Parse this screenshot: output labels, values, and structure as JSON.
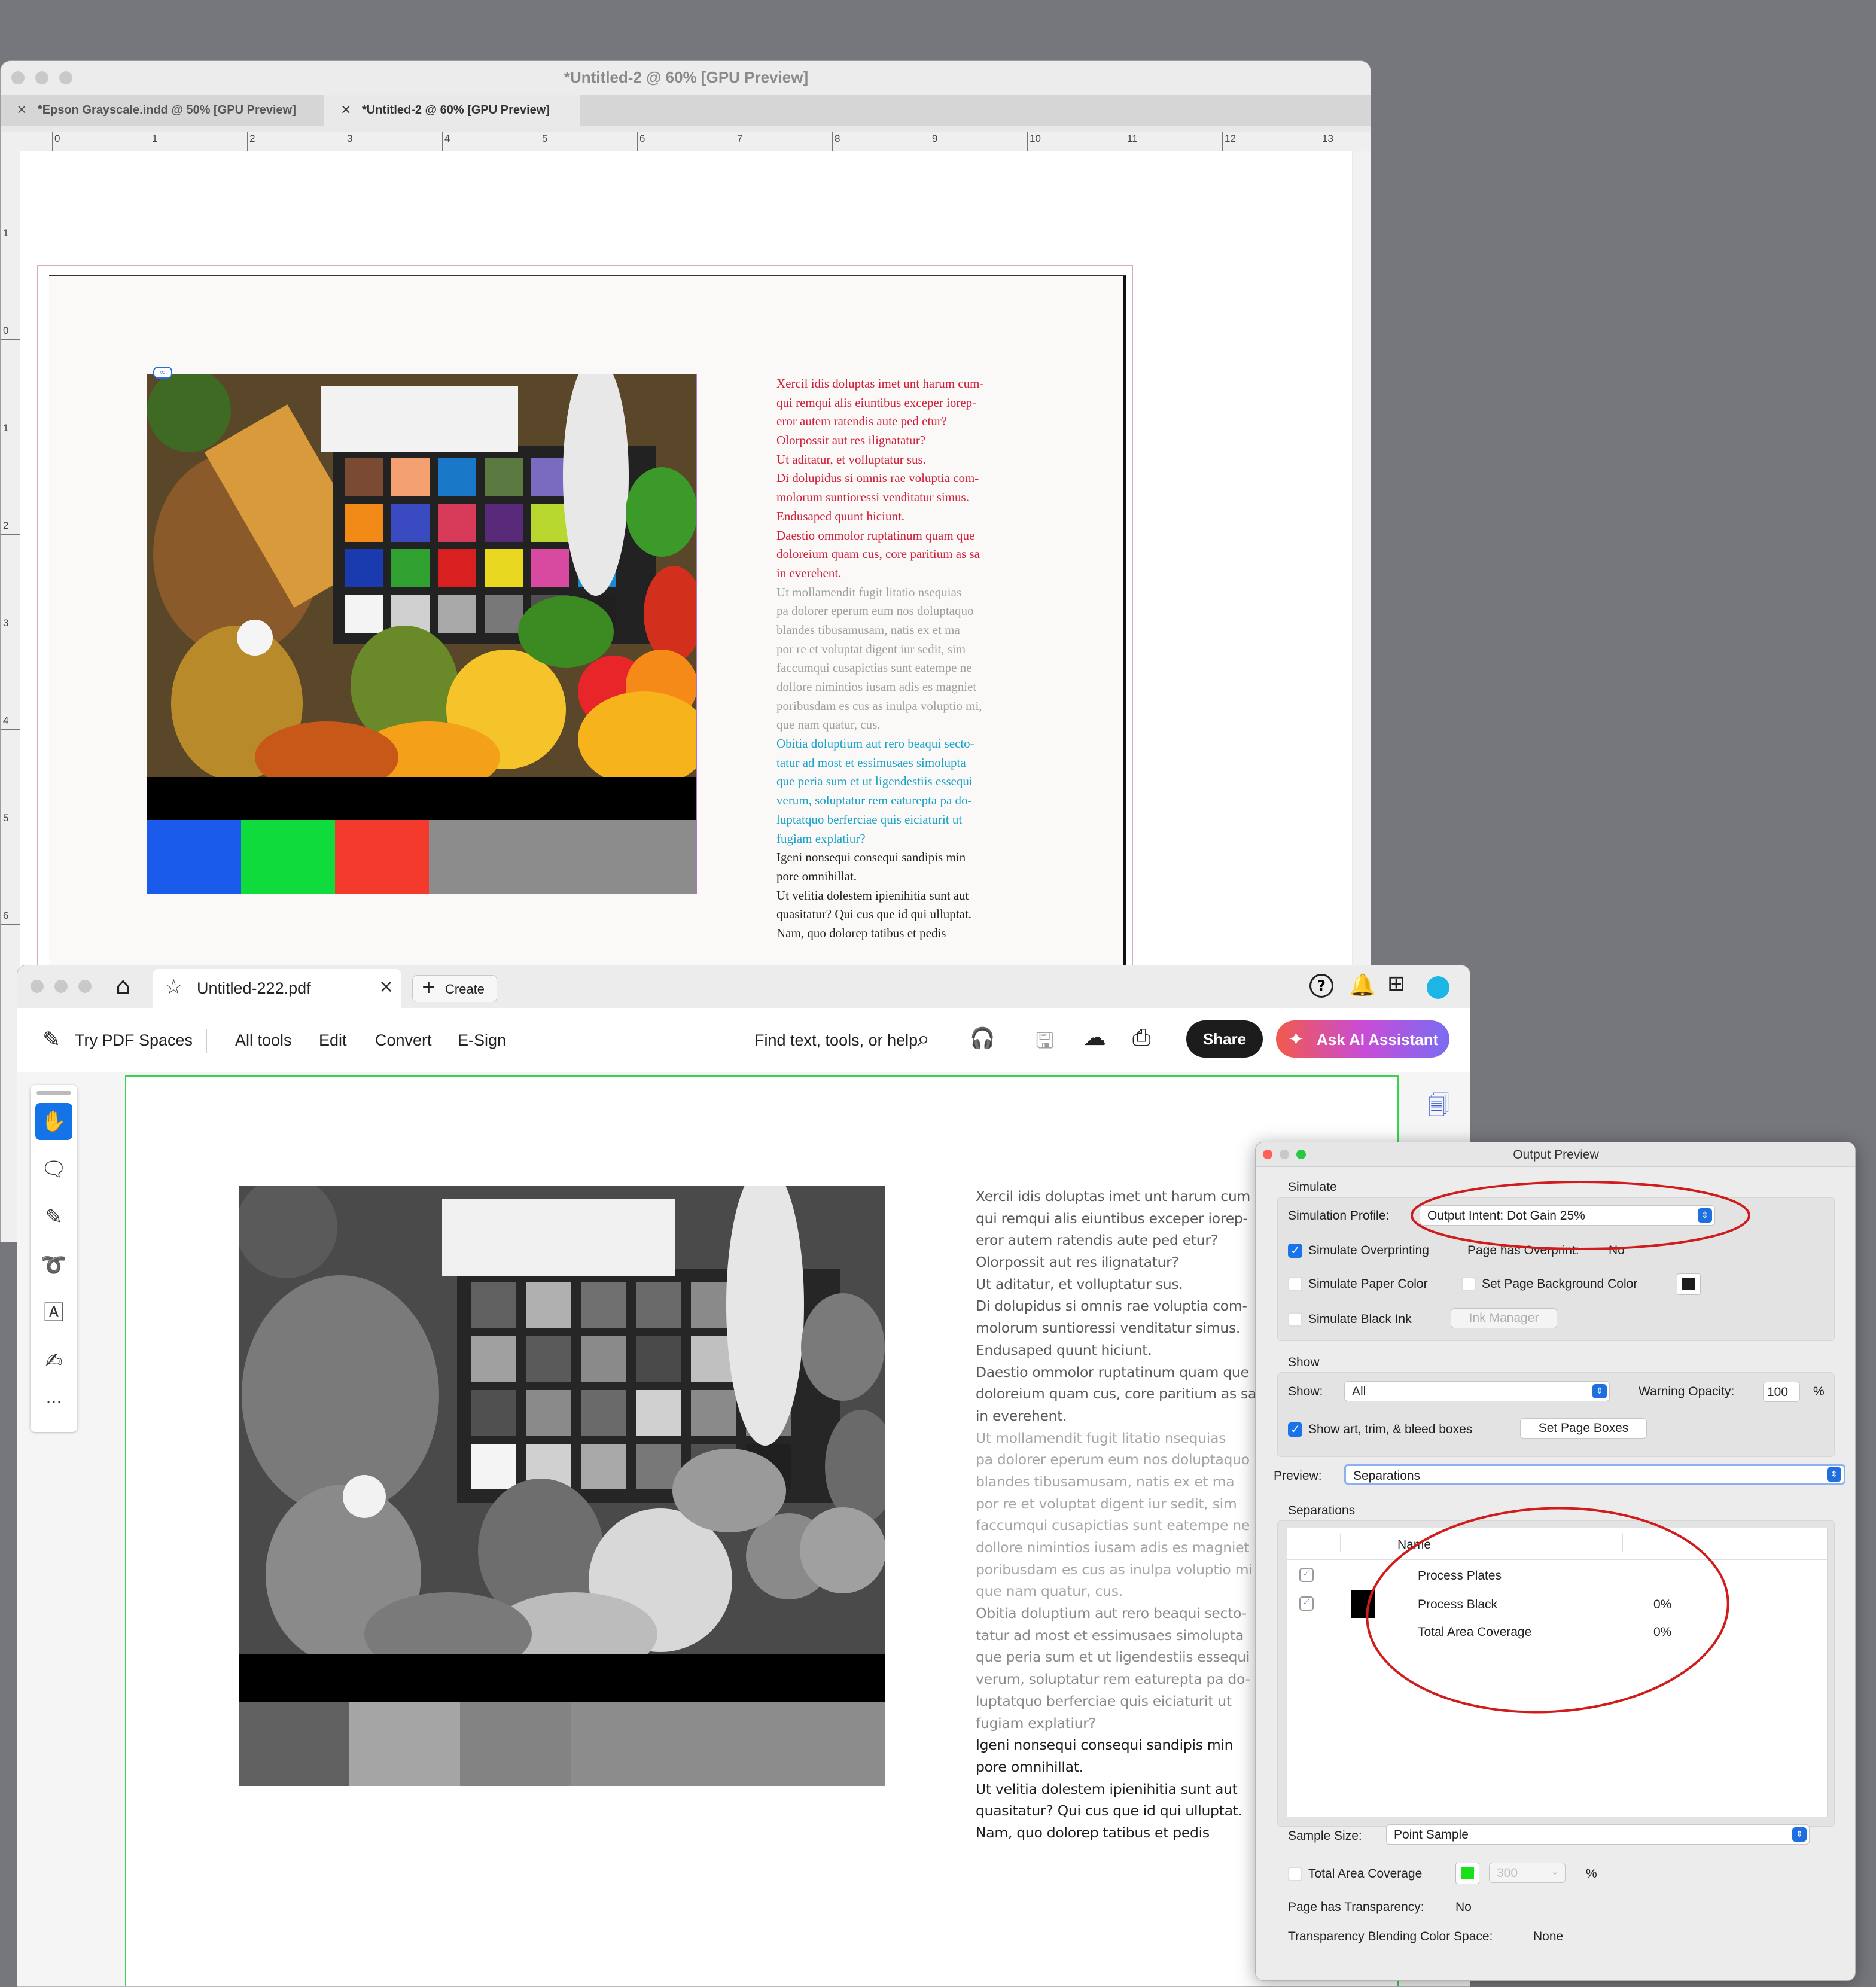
{
  "indesign": {
    "title": "*Untitled-2 @ 60% [GPU Preview]",
    "tabs": [
      {
        "label": "*Epson Grayscale.indd @ 50% [GPU Preview]",
        "active": false
      },
      {
        "label": "*Untitled-2 @ 60% [GPU Preview]",
        "active": true
      }
    ],
    "ruler_h": [
      "0",
      "1",
      "2",
      "3",
      "4",
      "5",
      "6",
      "7",
      "8",
      "9",
      "10",
      "11",
      "12",
      "13"
    ],
    "ruler_v": [
      "1",
      "0",
      "1",
      "2",
      "3",
      "4",
      "5",
      "6"
    ],
    "tab_close": "×",
    "text_lines": [
      {
        "t": "Xercil idis doluptas imet unt harum cum-",
        "c": "red"
      },
      {
        "t": "qui remqui alis eiuntibus exceper iorep-",
        "c": "red"
      },
      {
        "t": "eror autem ratendis aute ped etur?",
        "c": "red"
      },
      {
        "t": "Olorpossit aut res ilignatatur?",
        "c": "red"
      },
      {
        "t": "Ut aditatur, et volluptatur sus.",
        "c": "red"
      },
      {
        "t": "Di dolupidus si omnis rae voluptia com-",
        "c": "red"
      },
      {
        "t": "molorum suntioressi venditatur simus.",
        "c": "red"
      },
      {
        "t": "Endusaped quunt hiciunt.",
        "c": "red"
      },
      {
        "t": "Daestio ommolor ruptatinum quam que",
        "c": "red"
      },
      {
        "t": "doloreium quam cus, core paritium as sa",
        "c": "red"
      },
      {
        "t": "in everehent.",
        "c": "red"
      },
      {
        "t": "Ut mollamendit fugit litatio nsequias",
        "c": "gray"
      },
      {
        "t": "pa dolorer eperum eum nos doluptaquo",
        "c": "gray"
      },
      {
        "t": "blandes tibusamusam, natis ex et ma",
        "c": "gray"
      },
      {
        "t": "por re et voluptat digent iur sedit, sim",
        "c": "gray"
      },
      {
        "t": "faccumqui cusapictias sunt eatempe ne",
        "c": "gray"
      },
      {
        "t": "dollore nimintios iusam adis es magniet",
        "c": "gray"
      },
      {
        "t": "poribusdam es cus as inulpa voluptio mi,",
        "c": "gray"
      },
      {
        "t": "que nam quatur, cus.",
        "c": "gray"
      },
      {
        "t": "Obitia doluptium aut rero beaqui secto-",
        "c": "cyan"
      },
      {
        "t": "tatur ad most et essimusaes simolupta",
        "c": "cyan"
      },
      {
        "t": "que peria sum et ut ligendestiis essequi",
        "c": "cyan"
      },
      {
        "t": "verum, soluptatur rem eaturepta pa do-",
        "c": "cyan"
      },
      {
        "t": "luptatquo berferciae quis eiciaturit ut",
        "c": "cyan"
      },
      {
        "t": "fugiam explatiur?",
        "c": "cyan"
      },
      {
        "t": "Igeni nonsequi consequi sandipis min",
        "c": "black"
      },
      {
        "t": "pore omnihillat.",
        "c": "black"
      },
      {
        "t": "Ut velitia dolestem ipienihitia sunt aut",
        "c": "black"
      },
      {
        "t": "quasitatur? Qui cus que id qui ulluptat.",
        "c": "black"
      },
      {
        "t": "Nam, quo dolorep tatibus et pedis",
        "c": "black"
      }
    ],
    "text_colors": {
      "red": "#d0203a",
      "gray": "#a0a0a0",
      "cyan": "#1aa3c8",
      "black": "#222222"
    },
    "color_bar": [
      "#1b5bec",
      "#0fdc3c",
      "#f43a2c",
      "#8c8c8c"
    ]
  },
  "acrobat": {
    "tab_title": "Untitled-222.pdf",
    "tab_close": "×",
    "create_label": "Create",
    "menu": {
      "try": "Try PDF Spaces",
      "all_tools": "All tools",
      "edit": "Edit",
      "convert": "Convert",
      "esign": "E-Sign"
    },
    "search_label": "Find text, tools, or help",
    "share_label": "Share",
    "ai_label": "Ask AI Assistant",
    "more_tools": "···",
    "gray_bar": [
      "#606060",
      "#a5a5a5",
      "#838383",
      "#8c8c8c"
    ],
    "text_lines": [
      {
        "t": "Xercil idis doluptas imet unt harum cum",
        "c": "dark"
      },
      {
        "t": "qui remqui alis eiuntibus exceper iorep-",
        "c": "dark"
      },
      {
        "t": "eror autem ratendis aute ped etur?",
        "c": "dark"
      },
      {
        "t": "Olorpossit aut res ilignatatur?",
        "c": "dark"
      },
      {
        "t": "Ut aditatur, et volluptatur sus.",
        "c": "dark"
      },
      {
        "t": "Di dolupidus si omnis rae voluptia com-",
        "c": "dark"
      },
      {
        "t": "molorum suntioressi venditatur simus.",
        "c": "dark"
      },
      {
        "t": "Endusaped quunt hiciunt.",
        "c": "dark"
      },
      {
        "t": "Daestio ommolor ruptatinum quam que",
        "c": "dark"
      },
      {
        "t": "doloreium quam cus, core paritium as sa",
        "c": "dark"
      },
      {
        "t": "in everehent.",
        "c": "dark"
      },
      {
        "t": "Ut mollamendit fugit litatio nsequias",
        "c": "light"
      },
      {
        "t": "pa dolorer eperum eum nos doluptaquo",
        "c": "light"
      },
      {
        "t": "blandes tibusamusam, natis ex et ma",
        "c": "light"
      },
      {
        "t": "por re et voluptat digent iur sedit, sim",
        "c": "light"
      },
      {
        "t": "faccumqui cusapictias sunt eatempe ne",
        "c": "light"
      },
      {
        "t": "dollore nimintios iusam adis es magniet",
        "c": "light"
      },
      {
        "t": "poribusdam es cus as inulpa voluptio mi",
        "c": "light"
      },
      {
        "t": "que nam quatur, cus.",
        "c": "light"
      },
      {
        "t": "Obitia doluptium aut rero beaqui secto-",
        "c": "mid"
      },
      {
        "t": "tatur ad most et essimusaes simolupta",
        "c": "mid"
      },
      {
        "t": "que peria sum et ut ligendestiis essequi",
        "c": "mid"
      },
      {
        "t": "verum, soluptatur rem eaturepta pa do-",
        "c": "mid"
      },
      {
        "t": "luptatquo berferciae quis eiciaturit ut",
        "c": "mid"
      },
      {
        "t": "fugiam explatiur?",
        "c": "mid"
      },
      {
        "t": "Igeni nonsequi consequi sandipis min",
        "c": "black"
      },
      {
        "t": "pore omnihillat.",
        "c": "black"
      },
      {
        "t": "Ut velitia dolestem ipienihitia sunt aut",
        "c": "black"
      },
      {
        "t": "quasitatur? Qui cus que id qui ulluptat.",
        "c": "black"
      },
      {
        "t": "Nam, quo dolorep tatibus et pedis",
        "c": "black"
      }
    ],
    "text_colors": {
      "dark": "#5a5a5a",
      "light": "#a6a6a6",
      "mid": "#8a8a8a",
      "black": "#1e1e1e"
    }
  },
  "output_preview": {
    "title": "Output Preview",
    "simulate_heading": "Simulate",
    "simulation_profile_label": "Simulation Profile:",
    "simulation_profile_value": "Output Intent: Dot Gain 25%",
    "simulate_overprinting": {
      "label": "Simulate Overprinting",
      "checked": true
    },
    "page_has_overprint": "Page has Overprint:",
    "page_has_overprint_value": "No",
    "simulate_paper_color": {
      "label": "Simulate Paper Color",
      "checked": false
    },
    "set_page_bg_color": {
      "label": "Set Page Background Color",
      "checked": false
    },
    "simulate_black_ink": {
      "label": "Simulate Black Ink",
      "checked": false
    },
    "ink_manager": "Ink Manager",
    "show_heading": "Show",
    "show_label": "Show:",
    "show_value": "All",
    "warning_opacity_label": "Warning Opacity:",
    "warning_opacity_value": "100",
    "percent": "%",
    "show_boxes": {
      "label": "Show art, trim, & bleed boxes",
      "checked": true
    },
    "set_page_boxes": "Set Page Boxes",
    "preview_label": "Preview:",
    "preview_value": "Separations",
    "separations_heading": "Separations",
    "sep_col_name": "Name",
    "separations": [
      {
        "name": "Process Plates",
        "checked": true,
        "swatch": "",
        "value": ""
      },
      {
        "name": "Process Black",
        "checked": true,
        "swatch": "#000000",
        "value": "0%"
      },
      {
        "name": "Total Area Coverage",
        "checked": false,
        "swatch": "",
        "value": "0%"
      }
    ],
    "sample_size_label": "Sample Size:",
    "sample_size_value": "Point Sample",
    "total_area_coverage": {
      "label": "Total Area Coverage",
      "checked": false
    },
    "tac_swatch": "#19e019",
    "tac_value": "300",
    "page_transparency_label": "Page has Transparency:",
    "page_transparency_value": "No",
    "blending_label": "Transparency Blending Color Space:",
    "blending_value": "None",
    "annotation_color": "#d01c1c"
  }
}
